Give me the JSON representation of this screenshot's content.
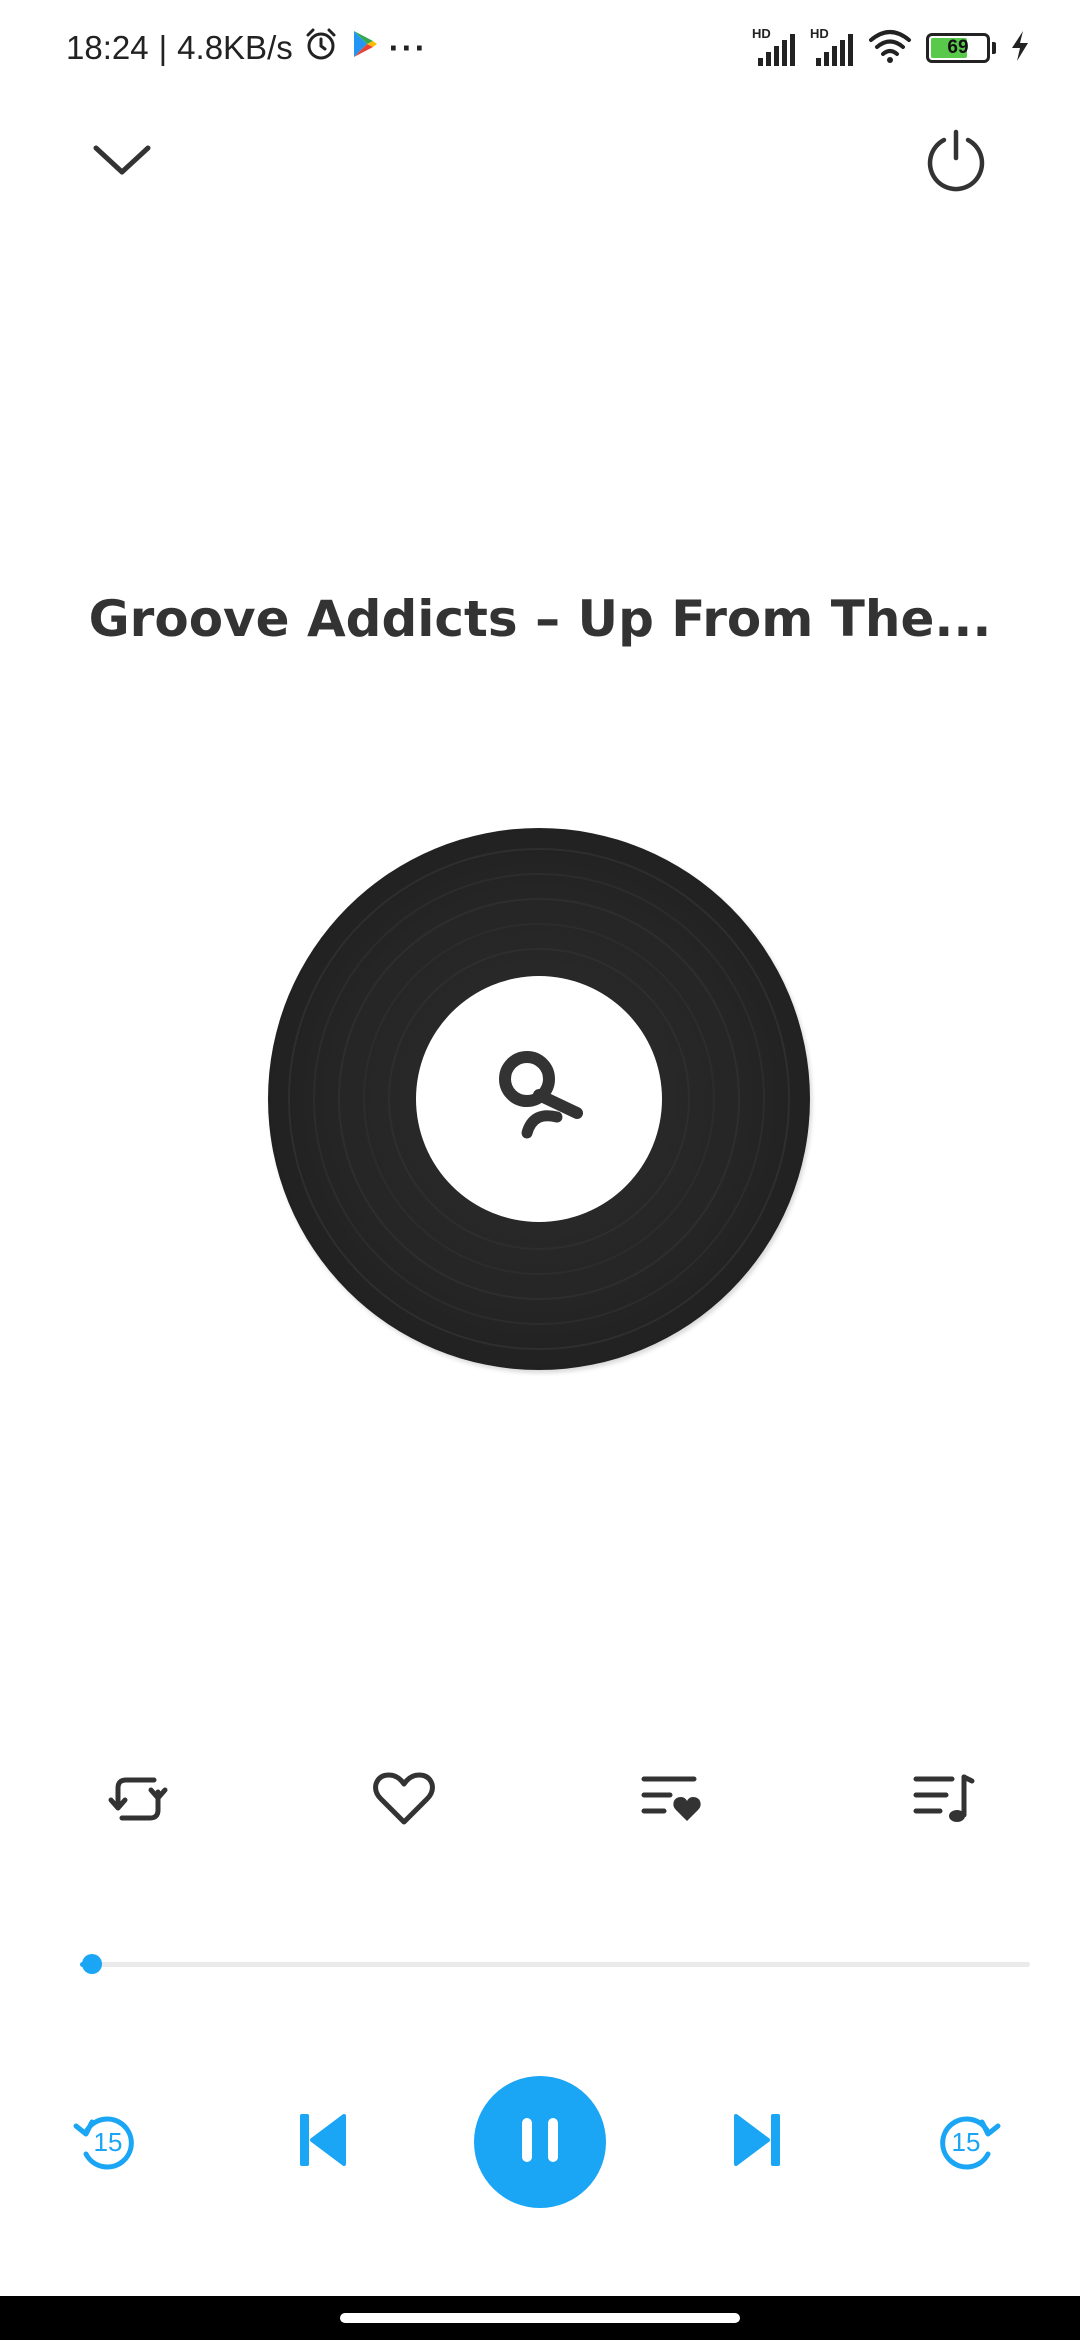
{
  "status_bar": {
    "time": "18:24",
    "separator": "|",
    "network_speed": "4.8KB/s",
    "more": "···",
    "icons": [
      "alarm-icon",
      "play-store-icon",
      "signal-hd-icon",
      "signal-hd-icon",
      "wifi-icon",
      "battery-icon",
      "charging-icon"
    ],
    "signal_label_1": "HD",
    "signal_label_2": "HD",
    "battery_level": "69",
    "battery_fraction": 0.69
  },
  "header": {
    "collapse_icon": "chevron-down-icon",
    "power_icon": "power-icon"
  },
  "track": {
    "title": "Groove Addicts – Up From The..."
  },
  "artwork": {
    "type": "vinyl-record",
    "center_icon": "app-logo-icon"
  },
  "actions": [
    {
      "name": "repeat-icon"
    },
    {
      "name": "heart-icon"
    },
    {
      "name": "add-to-favorites-playlist-icon"
    },
    {
      "name": "playlist-icon"
    }
  ],
  "progress": {
    "fraction": 0.013
  },
  "controls": {
    "rewind_seconds": "15",
    "forward_seconds": "15",
    "state": "playing"
  },
  "colors": {
    "accent": "#1aa5f5",
    "vinyl": "#262626",
    "text": "#333333",
    "battery_fill": "#58c94a"
  }
}
